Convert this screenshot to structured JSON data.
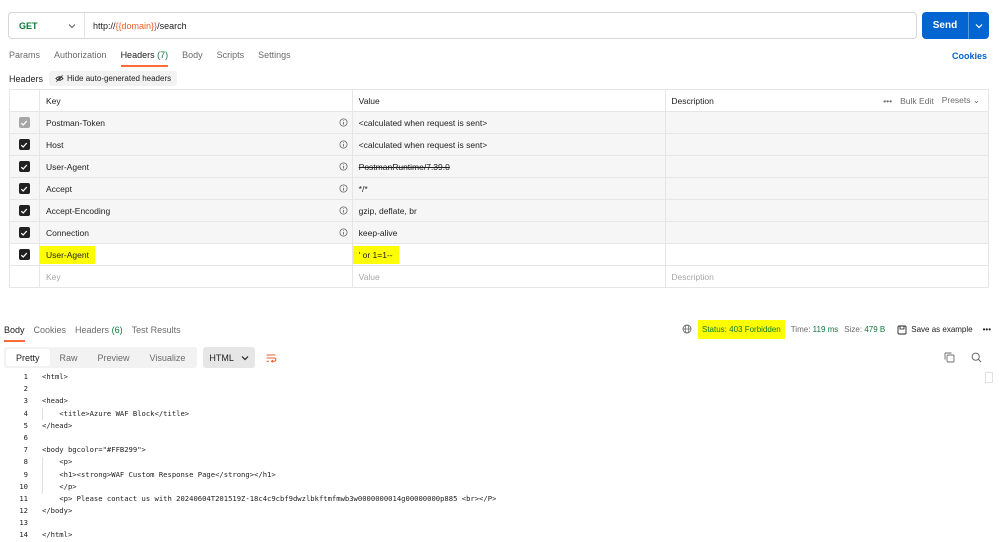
{
  "request": {
    "method": "GET",
    "url_prefix": "http://",
    "url_var": "{{domain}}",
    "url_suffix": "/search",
    "send_label": "Send"
  },
  "request_tabs": [
    {
      "label": "Params",
      "count": ""
    },
    {
      "label": "Authorization",
      "count": ""
    },
    {
      "label": "Headers",
      "count": "(7)"
    },
    {
      "label": "Body",
      "count": ""
    },
    {
      "label": "Scripts",
      "count": ""
    },
    {
      "label": "Settings",
      "count": ""
    }
  ],
  "cookies_link": "Cookies",
  "headers_section": {
    "title": "Headers",
    "hide_auto_label": "Hide auto-generated headers"
  },
  "table": {
    "columns": {
      "key": "Key",
      "value": "Value",
      "description": "Description"
    },
    "bulk_edit": "Bulk Edit",
    "presets": "Presets",
    "rows": [
      {
        "key": "Postman-Token",
        "value": "<calculated when request is sent>",
        "info": true
      },
      {
        "key": "Host",
        "value": "<calculated when request is sent>",
        "info": true
      },
      {
        "key": "User-Agent",
        "value": "PostmanRuntime/7.39.0",
        "info": true
      },
      {
        "key": "Accept",
        "value": "*/*",
        "info": true
      },
      {
        "key": "Accept-Encoding",
        "value": "gzip, deflate, br",
        "info": true
      },
      {
        "key": "Connection",
        "value": "keep-alive",
        "info": true
      },
      {
        "key": "User-Agent",
        "value": "' or 1=1--",
        "info": false
      }
    ],
    "placeholder": {
      "key": "Key",
      "value": "Value",
      "description": "Description"
    }
  },
  "response": {
    "tabs": [
      {
        "label": "Body",
        "count": ""
      },
      {
        "label": "Cookies",
        "count": ""
      },
      {
        "label": "Headers",
        "count": "(6)"
      },
      {
        "label": "Test Results",
        "count": ""
      }
    ],
    "status": "Status: 403 Forbidden",
    "time_label": "Time:",
    "time_value": "119 ms",
    "size_label": "Size:",
    "size_value": "479 B",
    "save_example": "Save as example",
    "format_buttons": [
      "Pretty",
      "Raw",
      "Preview",
      "Visualize"
    ],
    "language": "HTML"
  },
  "code_lines": [
    "<html>",
    "",
    "<head>",
    "    <title>Azure WAF Block</title>",
    "</head>",
    "",
    "<body bgcolor=\"#FFB299\">",
    "    <p>",
    "    <h1><strong>WAF Custom Response Page</strong></h1>",
    "    </p>",
    "    <p> Please contact us with 20240604T201519Z-18c4c9cbf9dwzlbkftmfmwb3w0000000014g00000000p885 <br></P>",
    "</body>",
    "",
    "</html>"
  ],
  "colors": {
    "accent": "#ff6c37",
    "send": "#0265d2",
    "method_get": "#0b7a3b",
    "highlight": "#ffff00"
  }
}
